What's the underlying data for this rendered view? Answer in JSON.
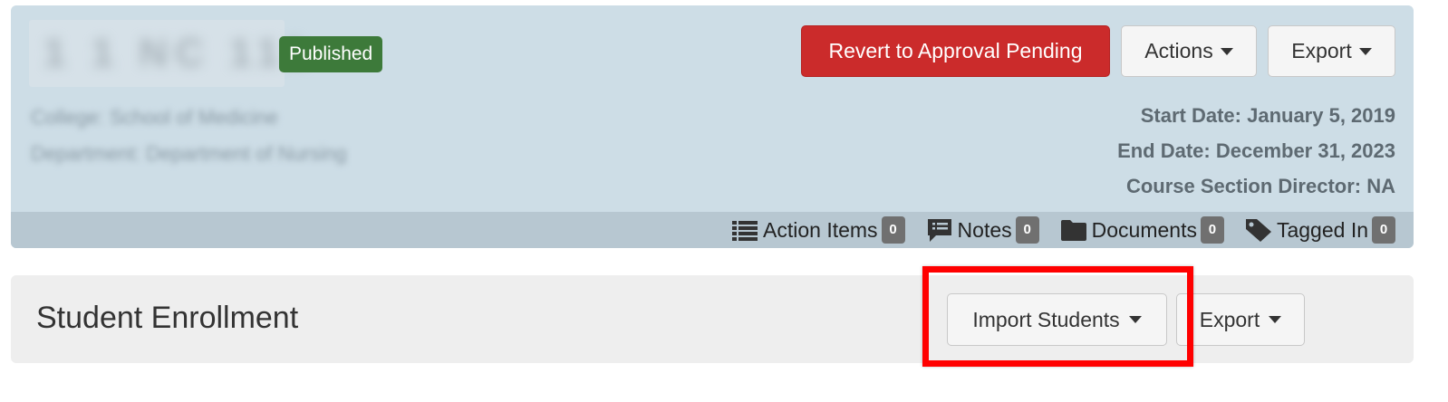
{
  "header": {
    "course_title": "1 1 NC 111",
    "status_badge": "Published",
    "college": "College: School of Medicine",
    "department": "Department: Department of Nursing",
    "buttons": {
      "revert": "Revert to Approval Pending",
      "actions": "Actions",
      "export": "Export"
    },
    "start_date": "Start Date: January 5, 2019",
    "end_date": "End Date: December 31, 2023",
    "director": "Course Section Director: NA",
    "info_bar": [
      {
        "label": "Action Items",
        "count": "0",
        "icon": "list-icon"
      },
      {
        "label": "Notes",
        "count": "0",
        "icon": "comment-icon"
      },
      {
        "label": "Documents",
        "count": "0",
        "icon": "folder-icon"
      },
      {
        "label": "Tagged In",
        "count": "0",
        "icon": "tag-icon"
      }
    ]
  },
  "enrollment": {
    "title": "Student Enrollment",
    "import_label": "Import Students",
    "export_label": "Export"
  },
  "colors": {
    "header_bg": "#cddde6",
    "info_bar_bg": "#b7c7d1",
    "danger": "#cb2b2b",
    "published": "#3d7a3a",
    "highlight": "#ff0000"
  }
}
